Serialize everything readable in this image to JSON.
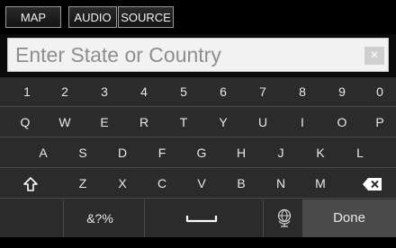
{
  "tabs": [
    {
      "label": "MAP"
    },
    {
      "label": "AUDIO"
    },
    {
      "label": "SOURCE"
    }
  ],
  "search": {
    "placeholder": "Enter State or Country",
    "clear_label": "×"
  },
  "keyboard": {
    "row1": [
      "1",
      "2",
      "3",
      "4",
      "5",
      "6",
      "7",
      "8",
      "9",
      "0"
    ],
    "row2": [
      "Q",
      "W",
      "E",
      "R",
      "T",
      "Y",
      "U",
      "I",
      "O",
      "P"
    ],
    "row3": [
      "A",
      "S",
      "D",
      "F",
      "G",
      "H",
      "J",
      "K",
      "L"
    ],
    "row4": [
      "Z",
      "X",
      "C",
      "V",
      "B",
      "N",
      "M"
    ],
    "symbols_label": "&?%",
    "done_label": "Done",
    "icons": {
      "shift": "shift-icon",
      "backspace": "backspace-icon",
      "space": "space-icon",
      "globe": "globe-icon"
    }
  },
  "colors": {
    "field_bg": "#f2f2f2",
    "keyboard_bg": "#2b2b2b",
    "done_bg": "#4a4a4a"
  }
}
